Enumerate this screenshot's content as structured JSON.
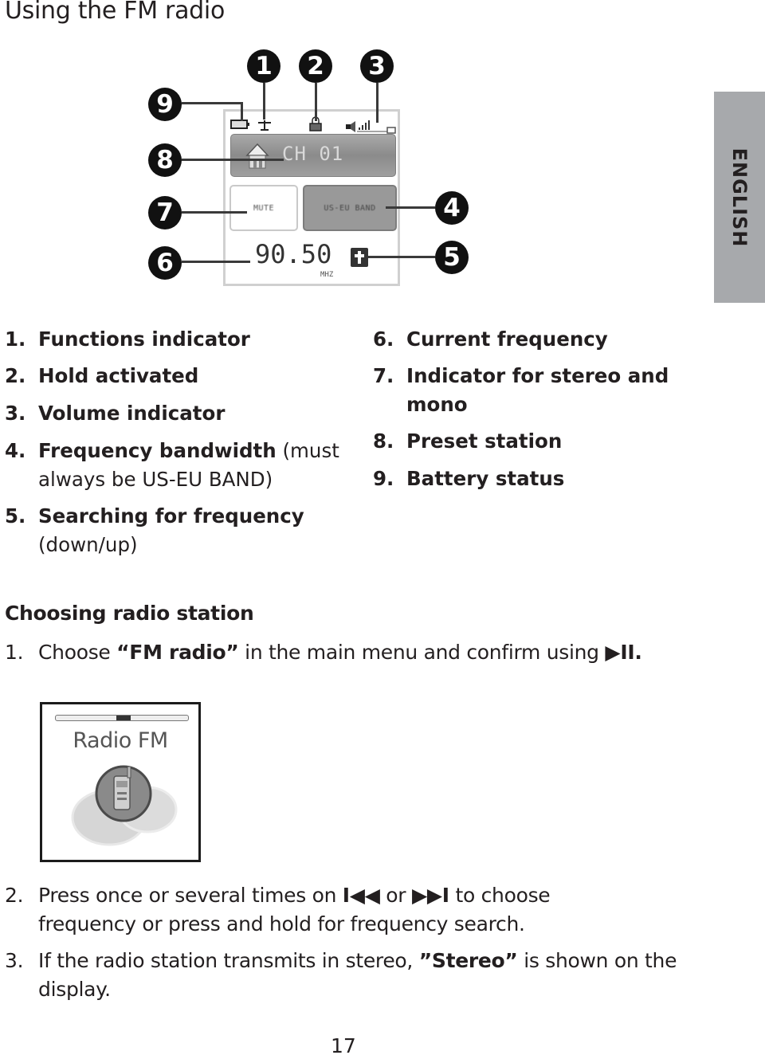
{
  "page": {
    "title": "Using the FM radio",
    "language_tab": "ENGLISH",
    "page_number": "17"
  },
  "diagram": {
    "callouts": [
      "1",
      "2",
      "3",
      "4",
      "5",
      "6",
      "7",
      "8",
      "9"
    ],
    "screen": {
      "preset_label": "CH 01",
      "mute_label": "MUTE",
      "band_label": "US-EU BAND",
      "frequency": "90.50",
      "unit": "MHZ",
      "icons": [
        "battery-icon",
        "antenna-icon",
        "lock-icon",
        "volume-icon",
        "home-icon",
        "search-up-icon"
      ]
    }
  },
  "legend": {
    "left": [
      {
        "num": "1.",
        "bold": "Functions indicator",
        "rest": "",
        "cont": ""
      },
      {
        "num": "2.",
        "bold": "Hold activated",
        "rest": "",
        "cont": ""
      },
      {
        "num": "3.",
        "bold": "Volume indicator",
        "rest": "",
        "cont": ""
      },
      {
        "num": "4.",
        "bold": "Frequency bandwidth",
        "rest": " (must",
        "cont": "always be US-EU BAND)"
      },
      {
        "num": "5.",
        "bold": "Searching for frequency",
        "rest": "",
        "cont": "(down/up)"
      }
    ],
    "right": [
      {
        "num": "6.",
        "bold": "Current frequency",
        "cont": ""
      },
      {
        "num": "7.",
        "bold": "Indicator for stereo and",
        "cont": "mono"
      },
      {
        "num": "8.",
        "bold": "Preset station",
        "cont": ""
      },
      {
        "num": "9.",
        "bold": "Battery status",
        "cont": ""
      }
    ]
  },
  "section": {
    "heading": "Choosing radio station",
    "steps": [
      {
        "num": "1.",
        "pre": "Choose ",
        "bold": "“FM radio”",
        "post": " in the main menu and confirm using ",
        "symbol": "▶II."
      },
      {
        "num": "2.",
        "pre": "Press once or several times on ",
        "sym1": "I◀◀",
        "mid": " or ",
        "sym2": "▶▶I",
        "post": " to choose",
        "cont": "frequency or press and hold for frequency search."
      },
      {
        "num": "3.",
        "pre": "If the radio station transmits in stereo, ",
        "bold": "”Stereo”",
        "post": " is shown on the",
        "cont": "display."
      }
    ],
    "menu_screenshot": {
      "title": "Radio FM"
    }
  }
}
